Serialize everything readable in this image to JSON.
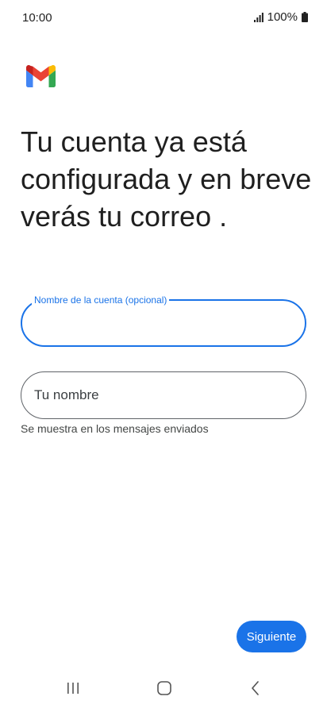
{
  "status_bar": {
    "time": "10:00",
    "battery": "100%",
    "icons": [
      "signal-icon",
      "battery-icon"
    ]
  },
  "app": {
    "logo": "gmail-logo"
  },
  "main": {
    "headline": "Tu cuenta ya está configurada y en breve verás tu correo .",
    "account_field": {
      "label": "Nombre de la cuenta (opcional)",
      "value": ""
    },
    "name_field": {
      "placeholder": "Tu nombre",
      "value": "",
      "helper": "Se muestra en los mensajes enviados"
    },
    "next_button_label": "Siguiente"
  },
  "navigation": {
    "icons": [
      "recents-icon",
      "home-icon",
      "back-icon"
    ]
  },
  "colors": {
    "accent": "#1a73e8",
    "text": "#1f1f1f",
    "outline": "#5f6368"
  }
}
